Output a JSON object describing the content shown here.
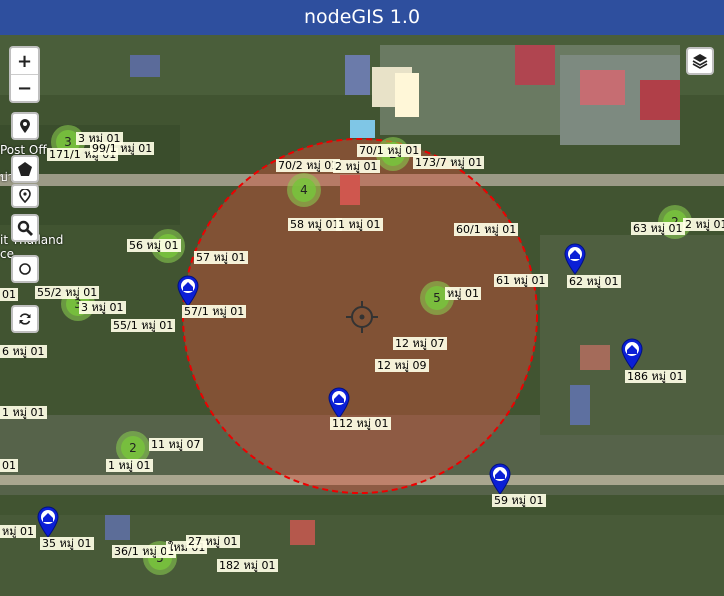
{
  "app": {
    "title": "nodeGIS 1.0"
  },
  "controls": {
    "zoom_in": "+",
    "zoom_out": "−"
  },
  "map_text": {
    "post_office": "Post Off",
    "thailand": "it Thailand",
    "thai_fragment": "บ่วมชิด",
    "ce": "ce"
  },
  "clusters": [
    {
      "count": "3"
    },
    {
      "count": "2"
    },
    {
      "count": "4"
    },
    {
      "count": "2"
    },
    {
      "count": "2"
    },
    {
      "count": "5"
    },
    {
      "count": "3"
    },
    {
      "count": "2"
    },
    {
      "count": "5"
    }
  ],
  "labels": [
    "3 หมู่ 01",
    "171/1 หมู่ 01",
    "99/1 หมู่ 01",
    "70/2 หมู่ 01",
    "2 หมู่ 01",
    "70/1 หมู่ 01",
    "173/7 หมู่ 01",
    "58 หมู่ 01",
    "1 หมู่ 01",
    "60/1 หมู่ 01",
    "63 หมู่ 01",
    "2 หมู่ 01",
    "56 หมู่ 01",
    "57 หมู่ 01",
    "61 หมู่ 01",
    "62 หมู่ 01",
    "01",
    "55/2 หมู่ 01",
    "3 หมู่ 01",
    "57/1 หมู่ 01",
    "6 หมู่ 01",
    "55/1 หมู่ 01",
    "12 หมู่ 07",
    "หมู่ 01",
    "12 หมู่ 09",
    "186 หมู่ 01",
    "112 หมู่ 01",
    "1 หมู่ 01",
    "11 หมู่ 07",
    "1 หมู่ 01",
    "01",
    "59 หมู่ 01",
    "35 หมู่ 01",
    "หมู่ 01",
    "36/1 หมู่ 01",
    "ใหม่ 01",
    "27 หมู่ 01",
    "182 หมู่ 01"
  ]
}
